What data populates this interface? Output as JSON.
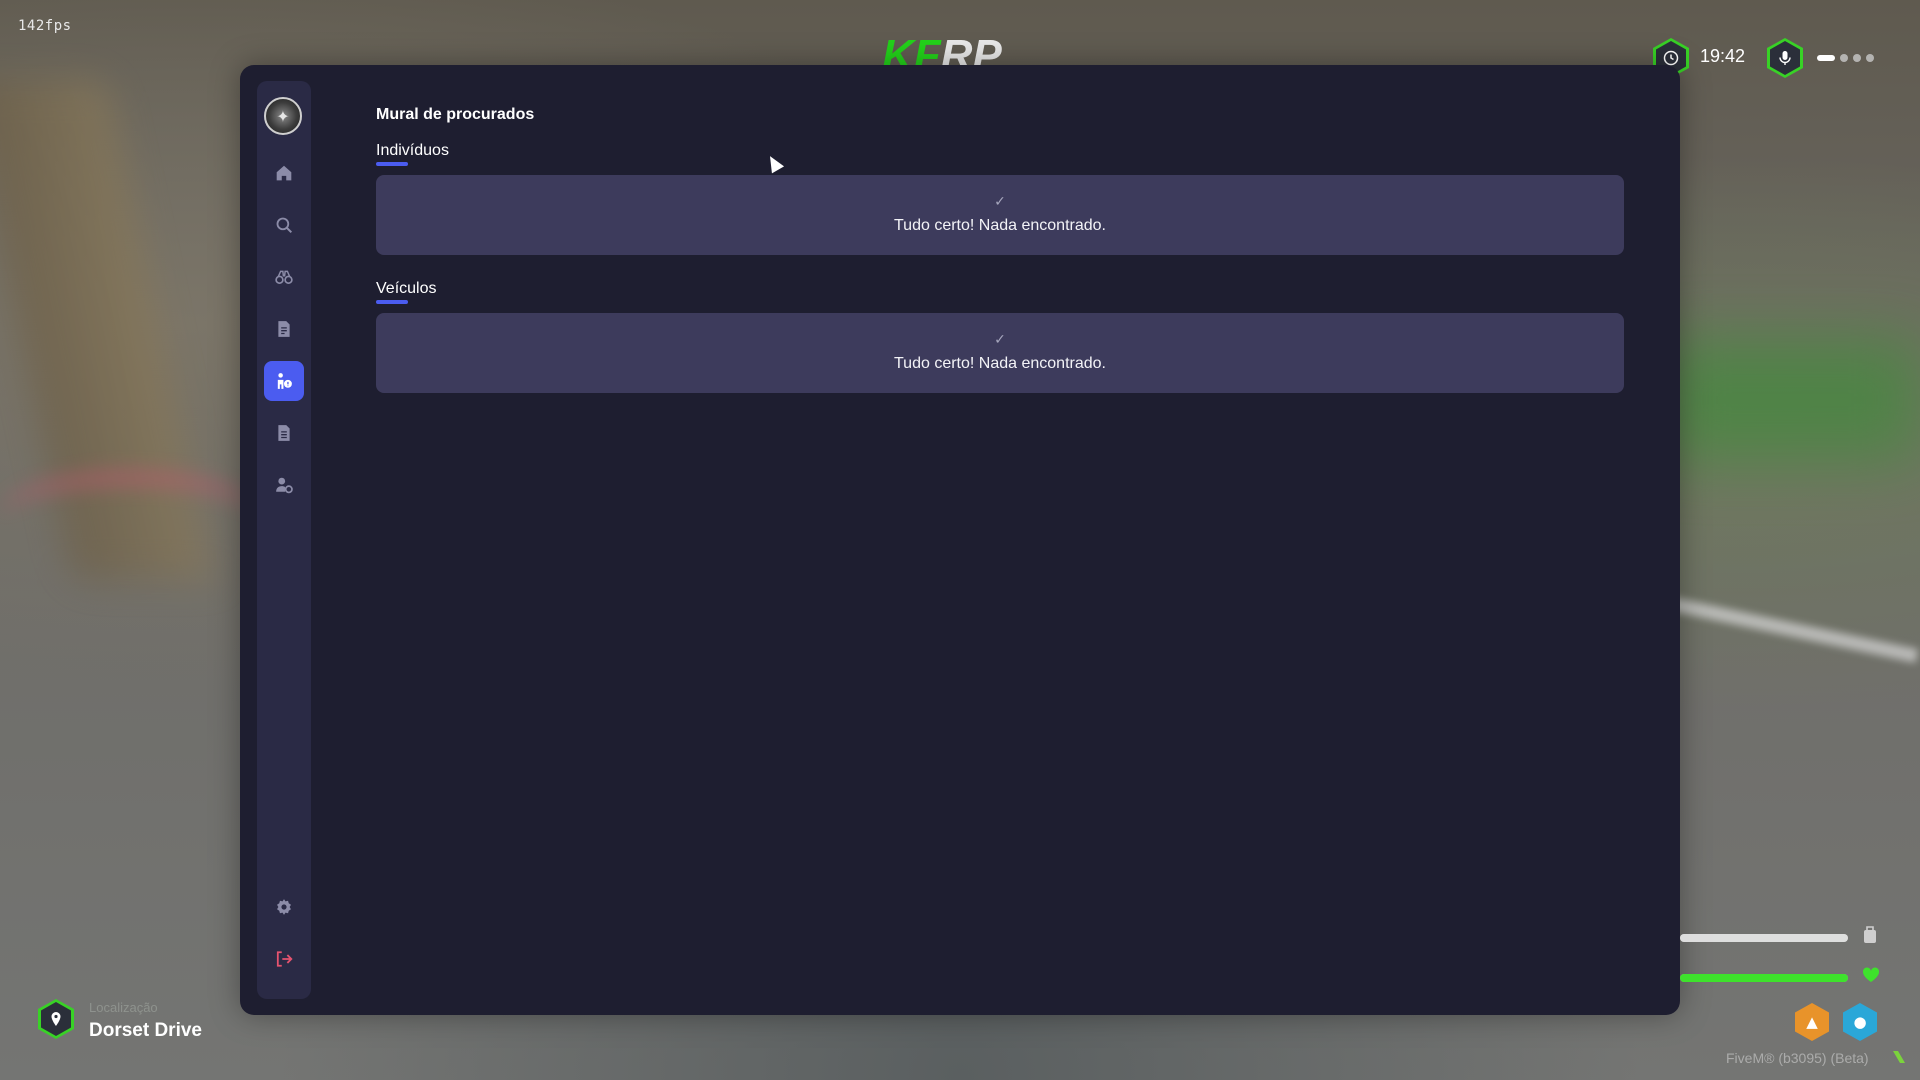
{
  "hud": {
    "fps": "142fps",
    "logo_part1": "KF",
    "logo_part2": "RP",
    "time": "19:42",
    "location_label": "Localização",
    "location_value": "Dorset Drive",
    "version": "FiveM® (b3095) (Beta)",
    "health_fill": 1.0,
    "armor_fill": 1.0,
    "voice_level": 1
  },
  "sidebar": {
    "items": [
      {
        "name": "home",
        "icon": "home-icon"
      },
      {
        "name": "search",
        "icon": "search-icon"
      },
      {
        "name": "binoculars",
        "icon": "binoculars-icon"
      },
      {
        "name": "report",
        "icon": "document-icon"
      },
      {
        "name": "wanted",
        "icon": "person-wanted-icon",
        "active": true
      },
      {
        "name": "records",
        "icon": "file-icon"
      },
      {
        "name": "officers",
        "icon": "user-gear-icon"
      },
      {
        "name": "settings",
        "icon": "gear-icon"
      },
      {
        "name": "logout",
        "icon": "logout-icon"
      }
    ]
  },
  "main": {
    "title": "Mural de procurados",
    "sections": [
      {
        "title": "Indivíduos",
        "empty_message": "Tudo certo! Nada encontrado."
      },
      {
        "title": "Veículos",
        "empty_message": "Tudo certo! Nada encontrado."
      }
    ]
  },
  "colors": {
    "accent": "#4b5cf0",
    "panel_bg": "#1e1e30",
    "sidebar_bg": "#2a2a45",
    "card_bg": "#3d3b5c",
    "hud_green": "#38d226",
    "logout_red": "#e5536f"
  }
}
